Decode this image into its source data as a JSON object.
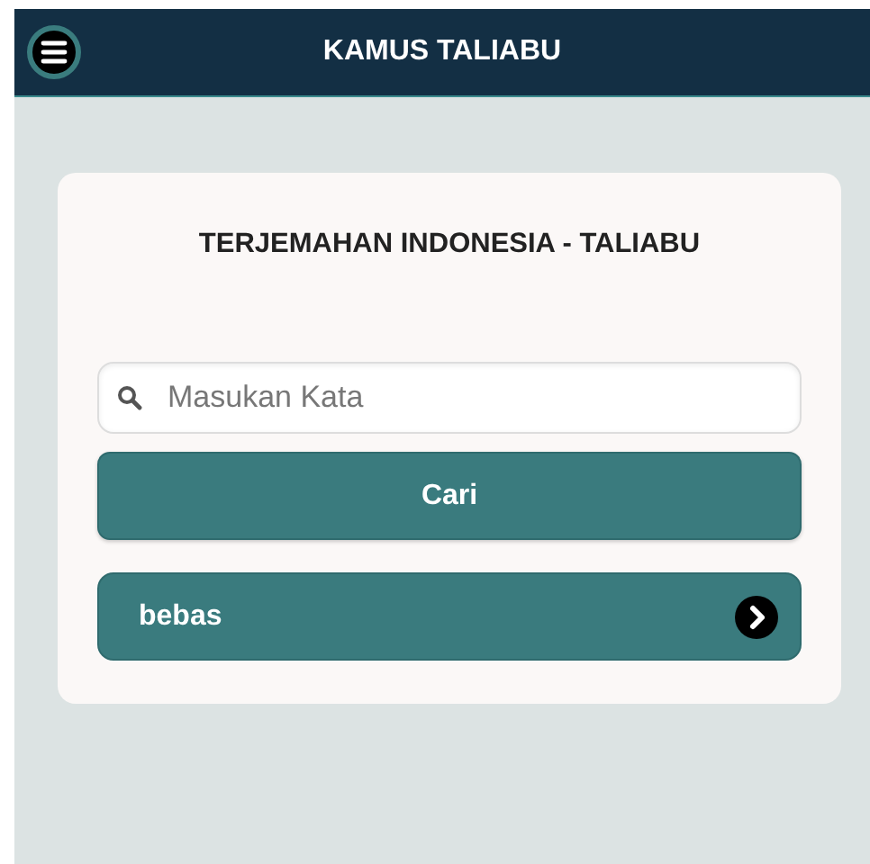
{
  "header": {
    "title": "KAMUS TALIABU"
  },
  "card": {
    "title": "TERJEMAHAN INDONESIA - TALIABU",
    "search": {
      "placeholder": "Masukan Kata"
    },
    "button": "Cari",
    "results": [
      {
        "word": "bebas"
      }
    ]
  }
}
